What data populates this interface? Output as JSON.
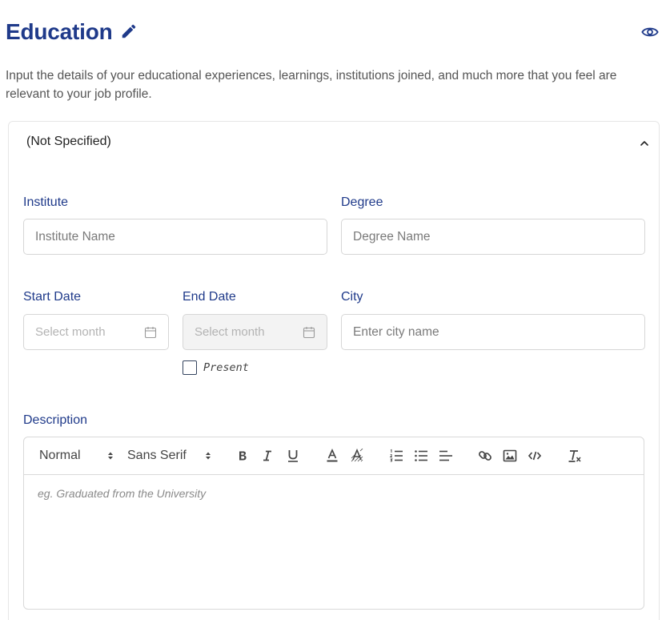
{
  "section": {
    "title": "Education",
    "description": "Input the details of your educational experiences, learnings, institutions joined, and much more that you feel are relevant to your job profile."
  },
  "entry": {
    "header": "(Not Specified)",
    "institute_label": "Institute",
    "institute_placeholder": "Institute Name",
    "degree_label": "Degree",
    "degree_placeholder": "Degree Name",
    "start_date_label": "Start Date",
    "start_date_placeholder": "Select month",
    "end_date_label": "End Date",
    "end_date_placeholder": "Select month",
    "city_label": "City",
    "city_placeholder": "Enter city name",
    "present_label": "Present",
    "description_label": "Description",
    "description_placeholder": "eg. Graduated from the University"
  },
  "toolbar": {
    "format_select": "Normal",
    "font_select": "Sans Serif",
    "icons": [
      "bold-icon",
      "italic-icon",
      "underline-icon",
      "text-color-icon",
      "background-color-icon",
      "ordered-list-icon",
      "bullet-list-icon",
      "align-left-icon",
      "link-icon",
      "image-icon",
      "code-icon",
      "clear-format-icon"
    ]
  },
  "colors": {
    "accent": "#1f3a8a",
    "border": "#d6d6d6",
    "disabled_bg": "#f3f3f3"
  }
}
